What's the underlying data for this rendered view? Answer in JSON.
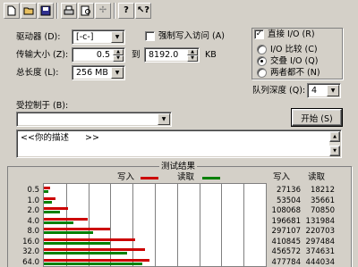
{
  "toolbar": {
    "icons": [
      "new-icon",
      "open-icon",
      "save-icon",
      "print-icon",
      "print-preview-icon",
      "move-icon",
      "help-icon",
      "context-help-icon"
    ]
  },
  "form": {
    "drive_label": "驱动器 (D):",
    "drive_value": "[-c-]",
    "transfer_size_label": "传输大小 (Z):",
    "transfer_from": "0.5",
    "to_label": "到",
    "transfer_to": "8192.0",
    "transfer_unit": "KB",
    "total_length_label": "总长度 (L):",
    "total_length_value": "256 MB",
    "force_write_label": "强制写入访问 (A)",
    "controlled_by_label": "受控制于 (B):",
    "controlled_by_value": ""
  },
  "options": {
    "direct_io_label": "直接 I/O (R)",
    "direct_io_checked": true,
    "io_compare_label": "I/O 比较 (C)",
    "alternate_label": "交叠 I/O (Q)",
    "neither_label": "两者都不 (N)",
    "queue_depth_label": "队列深度 (Q):",
    "queue_depth_value": "4",
    "start_button": "开始 (S)"
  },
  "description": {
    "prefix": "<<",
    "text": "你的描述",
    "suffix": ">>"
  },
  "results": {
    "group_title": "测试结果",
    "write_legend": "写入",
    "read_legend": "读取",
    "write_header": "写入",
    "read_header": "读取",
    "write_color": "#cc0000",
    "read_color": "#008000",
    "rows": [
      {
        "size": "0.5",
        "write": "27136",
        "read": "18212"
      },
      {
        "size": "1.0",
        "write": "53504",
        "read": "35661"
      },
      {
        "size": "2.0",
        "write": "108068",
        "read": "70850"
      },
      {
        "size": "4.0",
        "write": "196681",
        "read": "131984"
      },
      {
        "size": "8.0",
        "write": "297107",
        "read": "220703"
      },
      {
        "size": "16.0",
        "write": "410845",
        "read": "297484"
      },
      {
        "size": "32.0",
        "write": "456572",
        "read": "374631"
      },
      {
        "size": "64.0",
        "write": "477784",
        "read": "444034"
      }
    ]
  },
  "chart_data": {
    "type": "bar",
    "title": "测试结果",
    "categories": [
      "0.5",
      "1.0",
      "2.0",
      "4.0",
      "8.0",
      "16.0",
      "32.0",
      "64.0"
    ],
    "series": [
      {
        "name": "写入",
        "values": [
          27136,
          53504,
          108068,
          196681,
          297107,
          410845,
          456572,
          477784
        ]
      },
      {
        "name": "读取",
        "values": [
          18212,
          35661,
          70850,
          131984,
          220703,
          297484,
          374631,
          444034
        ]
      }
    ],
    "xlim": [
      0,
      1000000
    ],
    "grid": true,
    "legend": "top"
  }
}
